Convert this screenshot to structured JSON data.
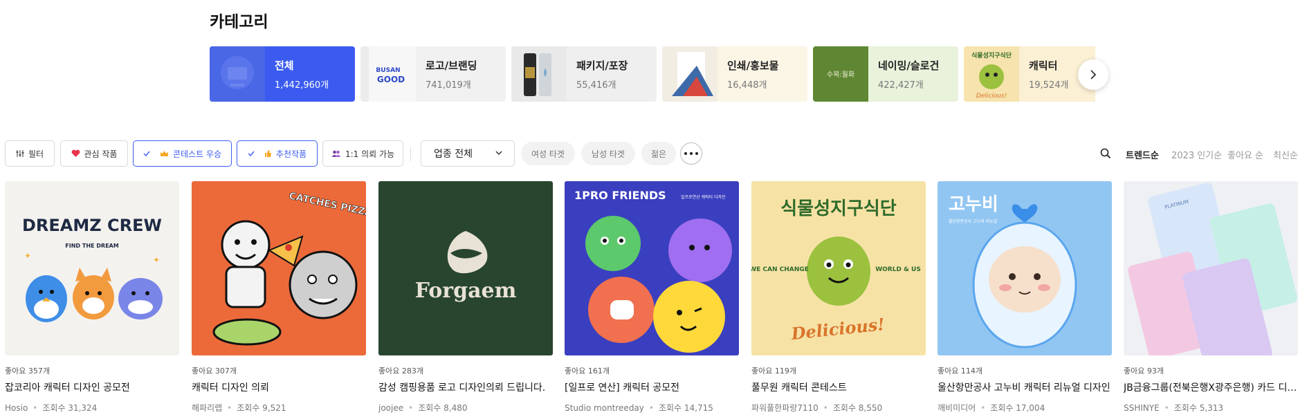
{
  "section_title": "카테고리",
  "categories": [
    {
      "name": "전체",
      "count": "1,442,960개"
    },
    {
      "name": "로고/브랜딩",
      "count": "741,019개"
    },
    {
      "name": "패키지/포장",
      "count": "55,416개"
    },
    {
      "name": "인쇄/홍보물",
      "count": "16,448개"
    },
    {
      "name": "네이밍/슬로건",
      "count": "422,427개"
    },
    {
      "name": "캐릭터",
      "count": "19,524개"
    }
  ],
  "category_thumb_text": {
    "logo": "BUSAN GOOD",
    "naming": "수목:월화",
    "character": "식물성지구식단",
    "character_sub": "Delicious!"
  },
  "filters": {
    "filter_label": "필터",
    "favorite_label": "관심 작품",
    "contest_label": "콘테스트 우승",
    "recommended_label": "추천작품",
    "one_on_one_label": "1:1 의뢰 가능",
    "industry_select": "업종 전체",
    "pills": [
      "여성 타겟",
      "남성 타겟",
      "젊은"
    ]
  },
  "sort_options": [
    "트렌드순",
    "2023 인기순",
    "좋아요 순",
    "최신순"
  ],
  "sort_active": "트렌드순",
  "colors": {
    "accent": "#3b5bf0",
    "favorite_heart": "#e8344e",
    "crown": "#f5a623"
  },
  "products": [
    {
      "likes": "좋아요 357개",
      "title": "잡코리아 캐릭터 디자인 공모전",
      "author": "Hosio",
      "views": "조회수 31,324",
      "art_title": "DREAMZ CREW",
      "art_sub": "FIND THE DREAM"
    },
    {
      "likes": "좋아요 307개",
      "title": "캐릭터 디자인 의뢰",
      "author": "해파리랩",
      "views": "조회수 9,521",
      "art_title": "CATCHES PIZZA"
    },
    {
      "likes": "좋아요 283개",
      "title": "감성 캠핑용품 로고 디자인의뢰 드립니다.",
      "author": "joojee",
      "views": "조회수 8,480",
      "art_title": "Forgaem"
    },
    {
      "likes": "좋아요 161개",
      "title": "[일프로 연산] 캐릭터 공모전",
      "author": "Studio montreeday",
      "views": "조회수 14,715",
      "art_title": "1PRO FRIENDS",
      "art_sub": "일프로연산 캐릭터 디자인"
    },
    {
      "likes": "좋아요 119개",
      "title": "풀무원 캐릭터 콘테스트",
      "author": "파워풀한파랑7110",
      "views": "조회수 8,550",
      "art_title": "식물성지구식단",
      "art_left": "WE CAN CHANGE",
      "art_right": "WORLD & US",
      "art_sub": "Delicious!"
    },
    {
      "likes": "좋아요 114개",
      "title": "울산항만공사 고누비 캐릭터 리뉴얼 디자인",
      "author": "깨비미디어",
      "views": "조회수 17,004",
      "art_title": "고누비",
      "art_sub": "울산항만공사 고누비 리뉴얼"
    },
    {
      "likes": "좋아요 93개",
      "title": "JB금융그룹(전북은행X광주은행) 카드 디자인",
      "author": "SSHINYE",
      "views": "조회수 5,313",
      "art_title": "PLATINUM"
    }
  ]
}
